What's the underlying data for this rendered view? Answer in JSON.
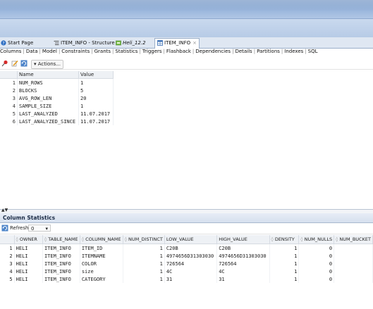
{
  "doc_tabs": [
    {
      "label": "Start Page"
    },
    {
      "label": "ITEM_INFO - Structure"
    },
    {
      "label": "Heli_12.2"
    },
    {
      "label": "ITEM_INFO"
    }
  ],
  "sub_tabs": [
    "Columns",
    "Data",
    "Model",
    "Constraints",
    "Grants",
    "Statistics",
    "Triggers",
    "Flashback",
    "Dependencies",
    "Details",
    "Partitions",
    "Indexes",
    "SQL"
  ],
  "toolbar": {
    "actions_label": "Actions..."
  },
  "stats": {
    "headers": [
      "Name",
      "Value"
    ],
    "rows": [
      {
        "n": "1",
        "name": "NUM_ROWS",
        "value": "1"
      },
      {
        "n": "2",
        "name": "BLOCKS",
        "value": "5"
      },
      {
        "n": "3",
        "name": "AVG_ROW_LEN",
        "value": "20"
      },
      {
        "n": "4",
        "name": "SAMPLE_SIZE",
        "value": "1"
      },
      {
        "n": "5",
        "name": "LAST_ANALYZED",
        "value": "11.07.2017"
      },
      {
        "n": "6",
        "name": "LAST_ANALYZED_SINCE",
        "value": "11.07.2017"
      }
    ]
  },
  "column_stats": {
    "title": "Column Statistics",
    "refresh_label": "Refresh:",
    "refresh_value": "0",
    "headers": [
      "OWNER",
      "TABLE_NAME",
      "COLUMN_NAME",
      "NUM_DISTINCT",
      "LOW_VALUE",
      "HIGH_VALUE",
      "DENSITY",
      "NUM_NULLS",
      "NUM_BUCKET"
    ],
    "rows": [
      {
        "n": "1",
        "owner": "HELI",
        "table": "ITEM_INFO",
        "column": "ITEM_ID",
        "distinct": "1",
        "low": "C20B",
        "high": "C20B",
        "density": "1",
        "nulls": "0"
      },
      {
        "n": "2",
        "owner": "HELI",
        "table": "ITEM_INFO",
        "column": "ITEMNAME",
        "distinct": "1",
        "low": "4974656D31303030",
        "high": "4974656D31303030",
        "density": "1",
        "nulls": "0"
      },
      {
        "n": "3",
        "owner": "HELI",
        "table": "ITEM_INFO",
        "column": "COLOR",
        "distinct": "1",
        "low": "726564",
        "high": "726564",
        "density": "1",
        "nulls": "0"
      },
      {
        "n": "4",
        "owner": "HELI",
        "table": "ITEM_INFO",
        "column": "size",
        "distinct": "1",
        "low": "4C",
        "high": "4C",
        "density": "1",
        "nulls": "0"
      },
      {
        "n": "5",
        "owner": "HELI",
        "table": "ITEM_INFO",
        "column": "CATEGORY",
        "distinct": "1",
        "low": "31",
        "high": "31",
        "density": "1",
        "nulls": "0"
      }
    ]
  }
}
